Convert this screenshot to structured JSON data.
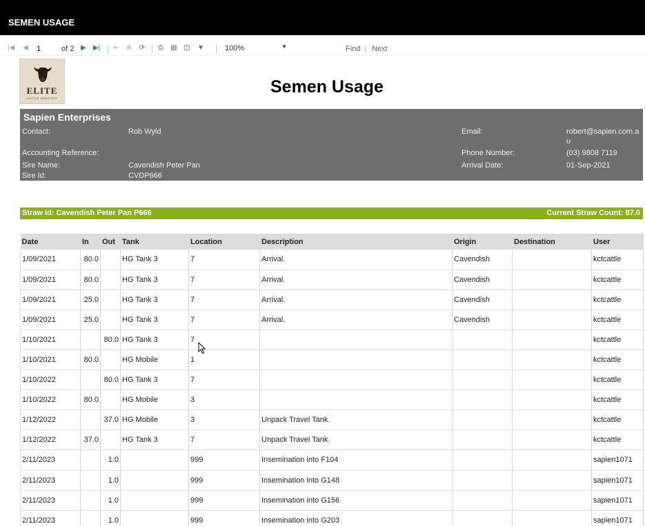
{
  "window": {
    "title": "SEMEN USAGE"
  },
  "toolbar": {
    "page_current": "1",
    "page_of": "of 2",
    "zoom": "100%",
    "find_label": "Find",
    "separator": "|",
    "next_label": "Next",
    "icons": [
      "first-page-icon",
      "prev-page-icon",
      "next-page-icon",
      "last-page-icon",
      "back-icon",
      "stop-icon",
      "refresh-icon",
      "print-icon",
      "print-layout-icon",
      "page-setup-icon",
      "export-icon"
    ]
  },
  "logo": {
    "word": "ELITE",
    "sub": "CATTLE GENETICS"
  },
  "report": {
    "title": "Semen Usage"
  },
  "info": {
    "company": "Sapien Enterprises",
    "contact_label": "Contact:",
    "contact": "Rob Wyld",
    "email_label": "Email:",
    "email_line1": "robert@sapien.com.a",
    "email_line2": "u",
    "accounting_label": "Accounting Reference:",
    "phone_label": "Phone Number:",
    "phone": "(03) 9808 7119",
    "sire_name_label": "Sire Name:",
    "sire_name": "Cavendish Peter Pan",
    "arrival_label": "Arrival Date:",
    "arrival": "01-Sep-2021",
    "sire_id_label": "Sire Id:",
    "sire_id": "CVDP666"
  },
  "straw": {
    "id_text": "Straw Id: Cavendish Peter Pan P666",
    "count_text": "Current Straw Count: 87.0"
  },
  "table": {
    "headers": [
      "Date",
      "In",
      "Out",
      "Tank",
      "Location",
      "Description",
      "Origin",
      "Destination",
      "User"
    ],
    "rows": [
      [
        "1/09/2021",
        "80.0",
        "",
        "HG Tank 3",
        "7",
        "Arrival.",
        "Cavendish",
        "",
        "kctcattle"
      ],
      [
        "1/09/2021",
        "80.0",
        "",
        "HG Tank 3",
        "7",
        "Arrival.",
        "Cavendish",
        "",
        "kctcattle"
      ],
      [
        "1/09/2021",
        "25.0",
        "",
        "HG Tank 3",
        "7",
        "Arrival.",
        "Cavendish",
        "",
        "kctcattle"
      ],
      [
        "1/09/2021",
        "25.0",
        "",
        "HG Tank 3",
        "7",
        "Arrival.",
        "Cavendish",
        "",
        "kctcattle"
      ],
      [
        "1/10/2021",
        "",
        "80.0",
        "HG Tank 3",
        "7",
        "",
        "",
        "",
        "kctcattle"
      ],
      [
        "1/10/2021",
        "80.0",
        "",
        "HG Mobile",
        "1",
        "",
        "",
        "",
        "kctcattle"
      ],
      [
        "1/10/2022",
        "",
        "80.0",
        "HG Tank 3",
        "7",
        "",
        "",
        "",
        "kctcattle"
      ],
      [
        "1/10/2022",
        "80.0",
        "",
        "HG Mobile",
        "3",
        "",
        "",
        "",
        "kctcattle"
      ],
      [
        "1/12/2022",
        "",
        "37.0",
        "HG Mobile",
        "3",
        "Unpack Travel Tank.",
        "",
        "",
        "kctcattle"
      ],
      [
        "1/12/2022",
        "37.0",
        "",
        "HG Tank 3",
        "7",
        "Unpack Travel Tank.",
        "",
        "",
        "kctcattle"
      ],
      [
        "2/11/2023",
        "",
        "1.0",
        "",
        "999",
        "Insemination into F104",
        "",
        "",
        "sapien1071"
      ],
      [
        "2/11/2023",
        "",
        "1.0",
        "",
        "999",
        "Insemination into G148",
        "",
        "",
        "sapien1071"
      ],
      [
        "2/11/2023",
        "",
        "1.0",
        "",
        "999",
        "Insemination into G156",
        "",
        "",
        "sapien1071"
      ],
      [
        "2/11/2023",
        "",
        "1.0",
        "",
        "999",
        "Insemination into G203",
        "",
        "",
        "sapien1071"
      ]
    ]
  },
  "colors": {
    "titlebar": "#000000",
    "infobox": "#6e6e6e",
    "strawbar": "#8ab01c",
    "header_row": "#dcdcdc"
  }
}
